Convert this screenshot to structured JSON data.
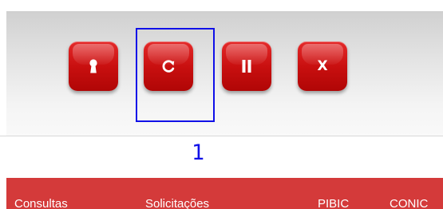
{
  "toolbar": {
    "buttons": [
      {
        "name": "lock",
        "icon": "keyhole-icon"
      },
      {
        "name": "reload",
        "icon": "reload-icon"
      },
      {
        "name": "pause",
        "icon": "pause-icon"
      },
      {
        "name": "close",
        "icon": "close-icon",
        "label": "X"
      }
    ],
    "button_color": "#c80f0f"
  },
  "annotation": {
    "label": "1",
    "color": "#1010e8",
    "target": "reload"
  },
  "menu": {
    "background": "#d43a3a",
    "items": [
      {
        "label": "Consultas"
      },
      {
        "label": "Solicitações"
      },
      {
        "label": "PIBIC"
      },
      {
        "label": "CONIC"
      }
    ]
  }
}
